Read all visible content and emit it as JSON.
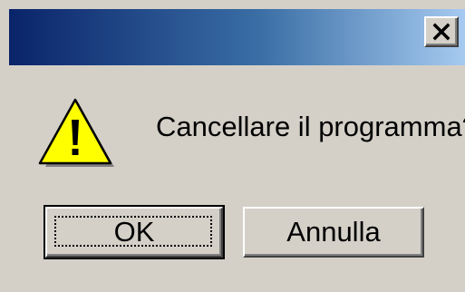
{
  "dialog": {
    "message": "Cancellare il programma?",
    "icon": "warning-icon",
    "buttons": {
      "ok_label": "OK",
      "cancel_label": "Annulla"
    },
    "close_icon": "close-icon"
  },
  "colors": {
    "titlebar_start": "#0a246a",
    "titlebar_end": "#a6caf0",
    "face": "#d4d0c8",
    "warning_fill": "#ffff00"
  }
}
